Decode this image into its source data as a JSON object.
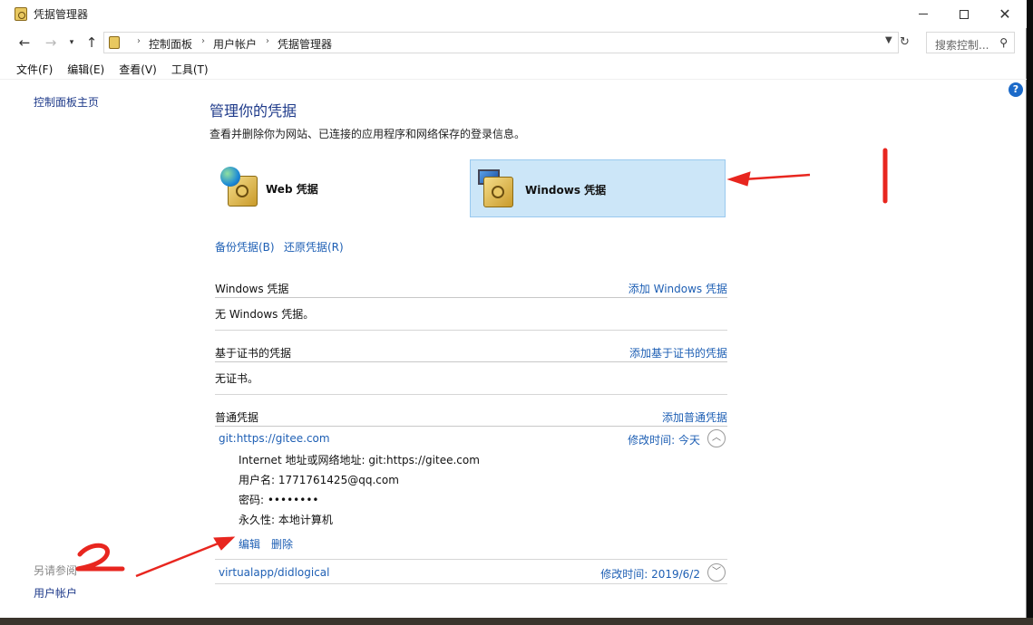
{
  "window": {
    "title": "凭据管理器",
    "controls": {
      "minimize": "—",
      "maximize": "□",
      "close": "✕"
    }
  },
  "nav": {
    "breadcrumbs": [
      "控制面板",
      "用户帐户",
      "凭据管理器"
    ],
    "search_placeholder": "搜索控制...",
    "icons": [
      "back-arrow-icon",
      "forward-arrow-icon",
      "recent-dropdown-icon",
      "up-arrow-icon",
      "refresh-icon",
      "search-icon"
    ]
  },
  "menu": [
    "文件(F)",
    "编辑(E)",
    "查看(V)",
    "工具(T)"
  ],
  "left": {
    "home": "控制面板主页",
    "see_also": "另请参阅",
    "user_accounts": "用户帐户"
  },
  "help": "?",
  "main": {
    "title": "管理你的凭据",
    "description": "查看并删除你为网站、已连接的应用程序和网络保存的登录信息。",
    "types": {
      "web": "Web 凭据",
      "windows": "Windows 凭据",
      "selected": "windows"
    },
    "backup": "备份凭据(B)",
    "restore": "还原凭据(R)",
    "sections": {
      "windows": {
        "title": "Windows 凭据",
        "add": "添加 Windows 凭据",
        "empty": "无 Windows 凭据。"
      },
      "cert": {
        "title": "基于证书的凭据",
        "add": "添加基于证书的凭据",
        "empty": "无证书。"
      },
      "generic": {
        "title": "普通凭据",
        "add": "添加普通凭据"
      }
    },
    "entries": [
      {
        "name": "git:https://gitee.com",
        "modified": "修改时间: 今天",
        "expanded": true,
        "details": {
          "address": "Internet 地址或网络地址: git:https://gitee.com",
          "username": "用户名: 1771761425@qq.com",
          "password": "密码: ••••••••",
          "persistence": "永久性: 本地计算机"
        },
        "edit": "编辑",
        "delete": "删除"
      },
      {
        "name": "virtualapp/didlogical",
        "modified": "修改时间: 2019/6/2",
        "expanded": false
      }
    ]
  },
  "colors": {
    "link": "#1e5fb4",
    "heading": "#1e3a8a",
    "selected_bg": "#cce6f8",
    "annotation": "#e8261f"
  }
}
